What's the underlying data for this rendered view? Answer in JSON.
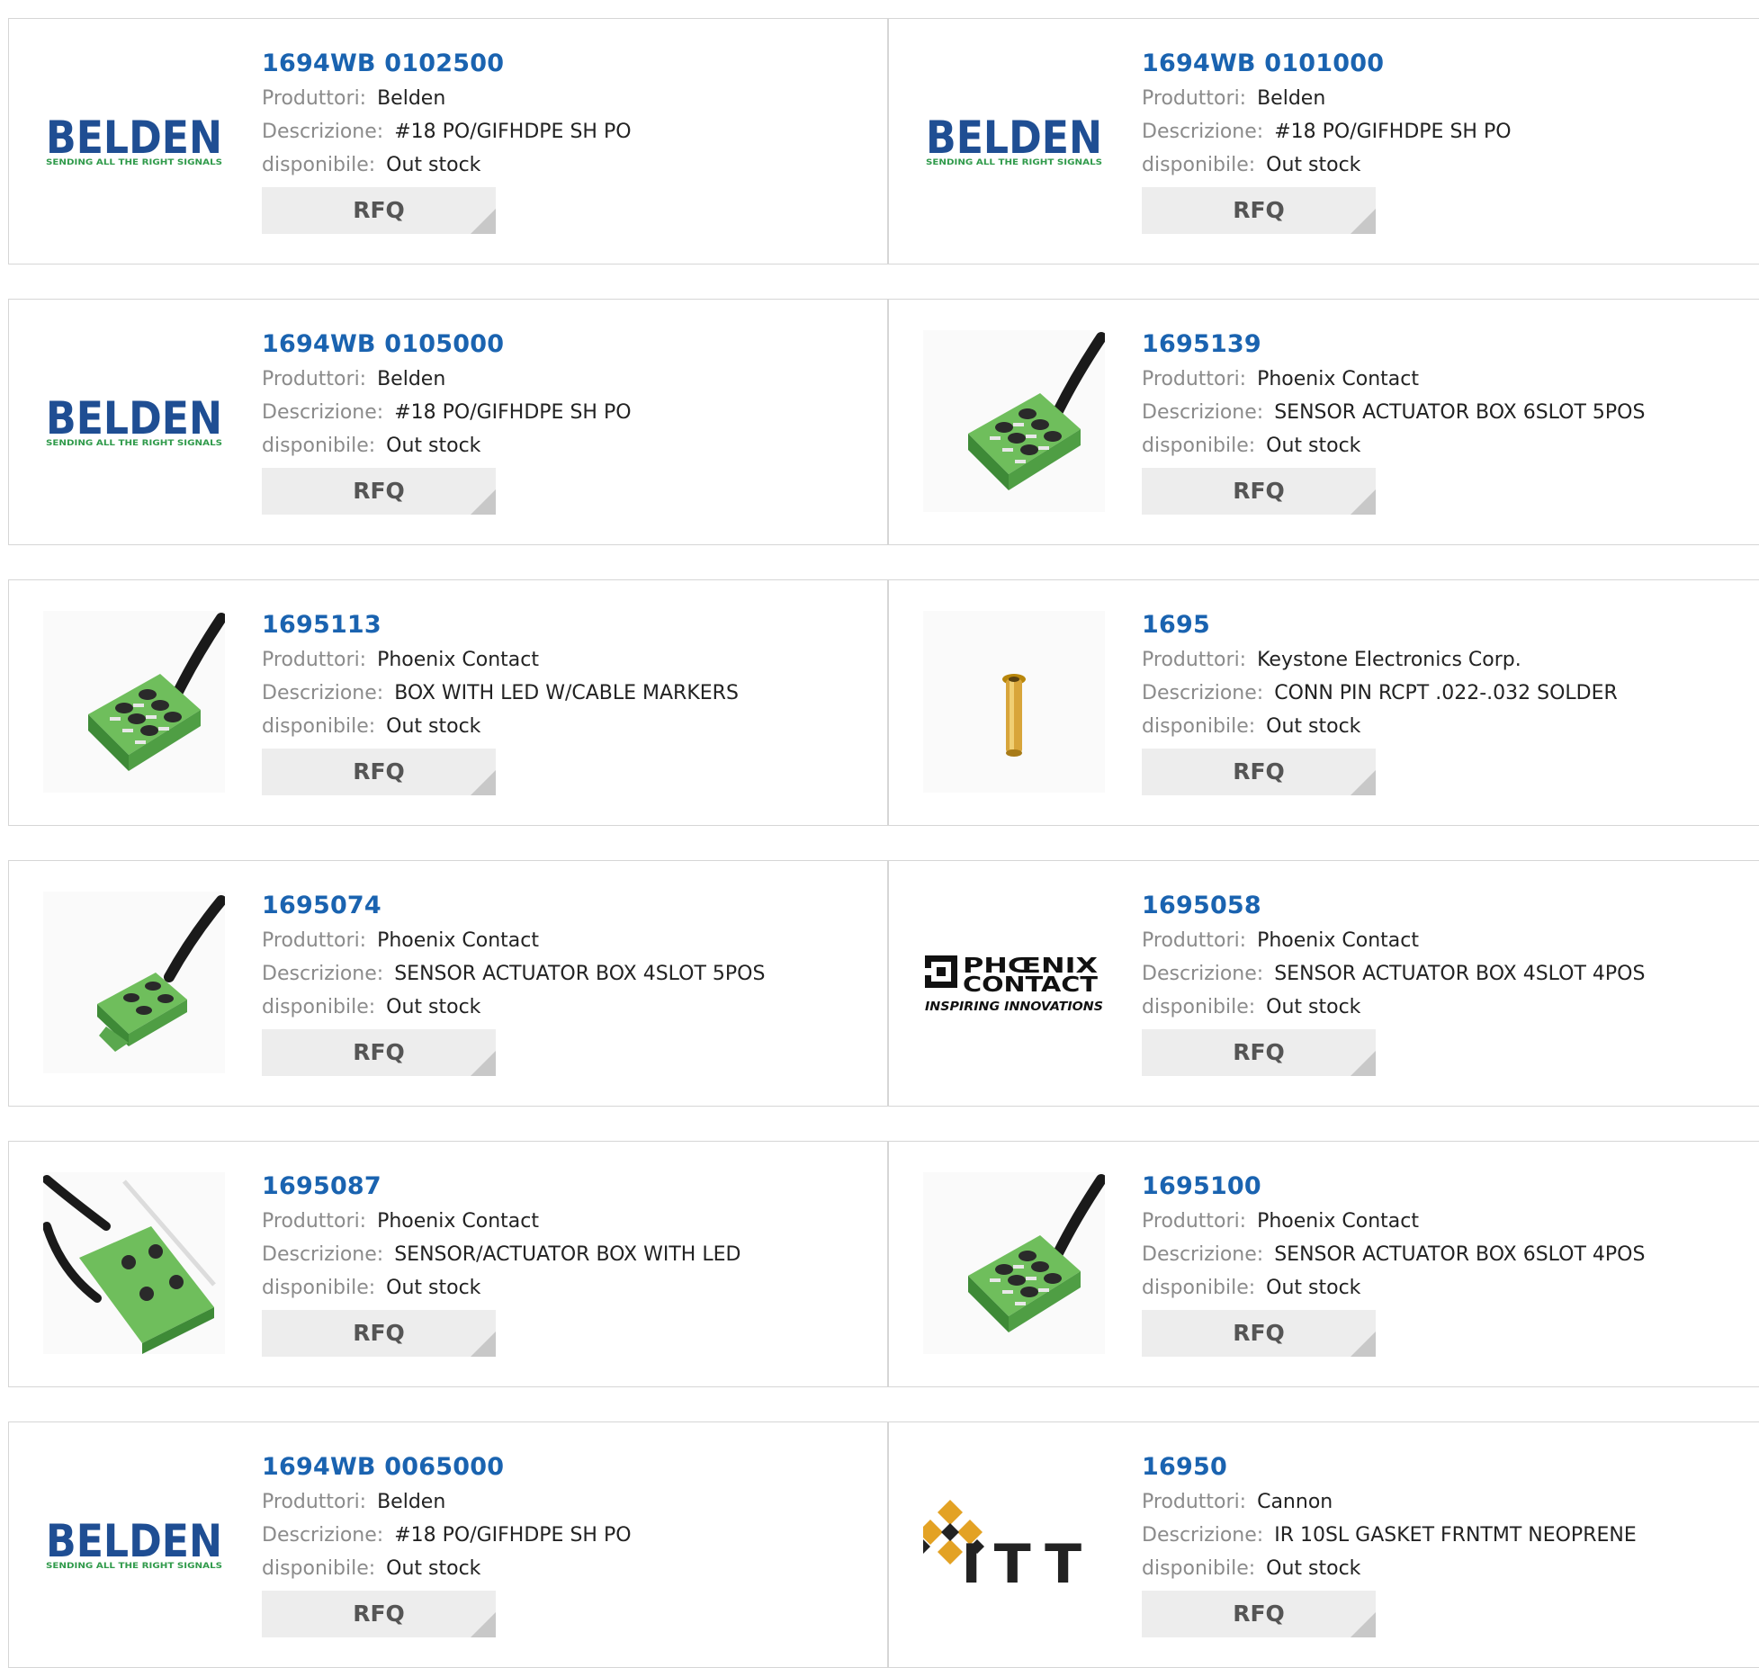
{
  "labels": {
    "manufacturer": "Produttori:",
    "description": "Descrizione:",
    "availability": "disponibile:",
    "rfq": "RFQ"
  },
  "logos": {
    "belden_word": "BELDEN",
    "belden_tagline": "SENDING ALL THE RIGHT SIGNALS",
    "phoenix_line1": "PHŒNIX",
    "phoenix_line2": "CONTACT",
    "phoenix_tagline": "INSPIRING INNOVATIONS",
    "itt_word": "ITT"
  },
  "colors": {
    "part_link": "#1a63b0",
    "belden_blue": "#1f4e93",
    "belden_green": "#2f9a4a",
    "component_green": "#5aa84e",
    "itt_gold": "#e3a224",
    "rfq_bg": "#ededed"
  },
  "products": [
    {
      "part": "1694WB 0102500",
      "manufacturer": "Belden",
      "description": "#18 PO/GIFHDPE SH PO",
      "availability": "Out stock",
      "image": "belden-logo"
    },
    {
      "part": "1694WB 0101000",
      "manufacturer": "Belden",
      "description": "#18 PO/GIFHDPE SH PO",
      "availability": "Out stock",
      "image": "belden-logo"
    },
    {
      "part": "1694WB 0105000",
      "manufacturer": "Belden",
      "description": "#18 PO/GIFHDPE SH PO",
      "availability": "Out stock",
      "image": "belden-logo"
    },
    {
      "part": "1695139",
      "manufacturer": "Phoenix Contact",
      "description": "SENSOR ACTUATOR BOX 6SLOT 5POS",
      "availability": "Out stock",
      "image": "sensor-box-6slot"
    },
    {
      "part": "1695113",
      "manufacturer": "Phoenix Contact",
      "description": "BOX WITH LED W/CABLE MARKERS",
      "availability": "Out stock",
      "image": "sensor-box-6slot"
    },
    {
      "part": "1695",
      "manufacturer": "Keystone Electronics Corp.",
      "description": "CONN PIN RCPT .022-.032 SOLDER",
      "availability": "Out stock",
      "image": "pin-receptacle"
    },
    {
      "part": "1695074",
      "manufacturer": "Phoenix Contact",
      "description": "SENSOR ACTUATOR BOX 4SLOT 5POS",
      "availability": "Out stock",
      "image": "sensor-box-4slot"
    },
    {
      "part": "1695058",
      "manufacturer": "Phoenix Contact",
      "description": "SENSOR ACTUATOR BOX 4SLOT 4POS",
      "availability": "Out stock",
      "image": "phoenix-logo"
    },
    {
      "part": "1695087",
      "manufacturer": "Phoenix Contact",
      "description": "SENSOR/ACTUATOR BOX WITH LED",
      "availability": "Out stock",
      "image": "sensor-box-led"
    },
    {
      "part": "1695100",
      "manufacturer": "Phoenix Contact",
      "description": "SENSOR ACTUATOR BOX 6SLOT 4POS",
      "availability": "Out stock",
      "image": "sensor-box-6slot"
    },
    {
      "part": "1694WB 0065000",
      "manufacturer": "Belden",
      "description": "#18 PO/GIFHDPE SH PO",
      "availability": "Out stock",
      "image": "belden-logo"
    },
    {
      "part": "16950",
      "manufacturer": "Cannon",
      "description": "IR 10SL GASKET FRNTMT NEOPRENE",
      "availability": "Out stock",
      "image": "itt-logo"
    }
  ]
}
